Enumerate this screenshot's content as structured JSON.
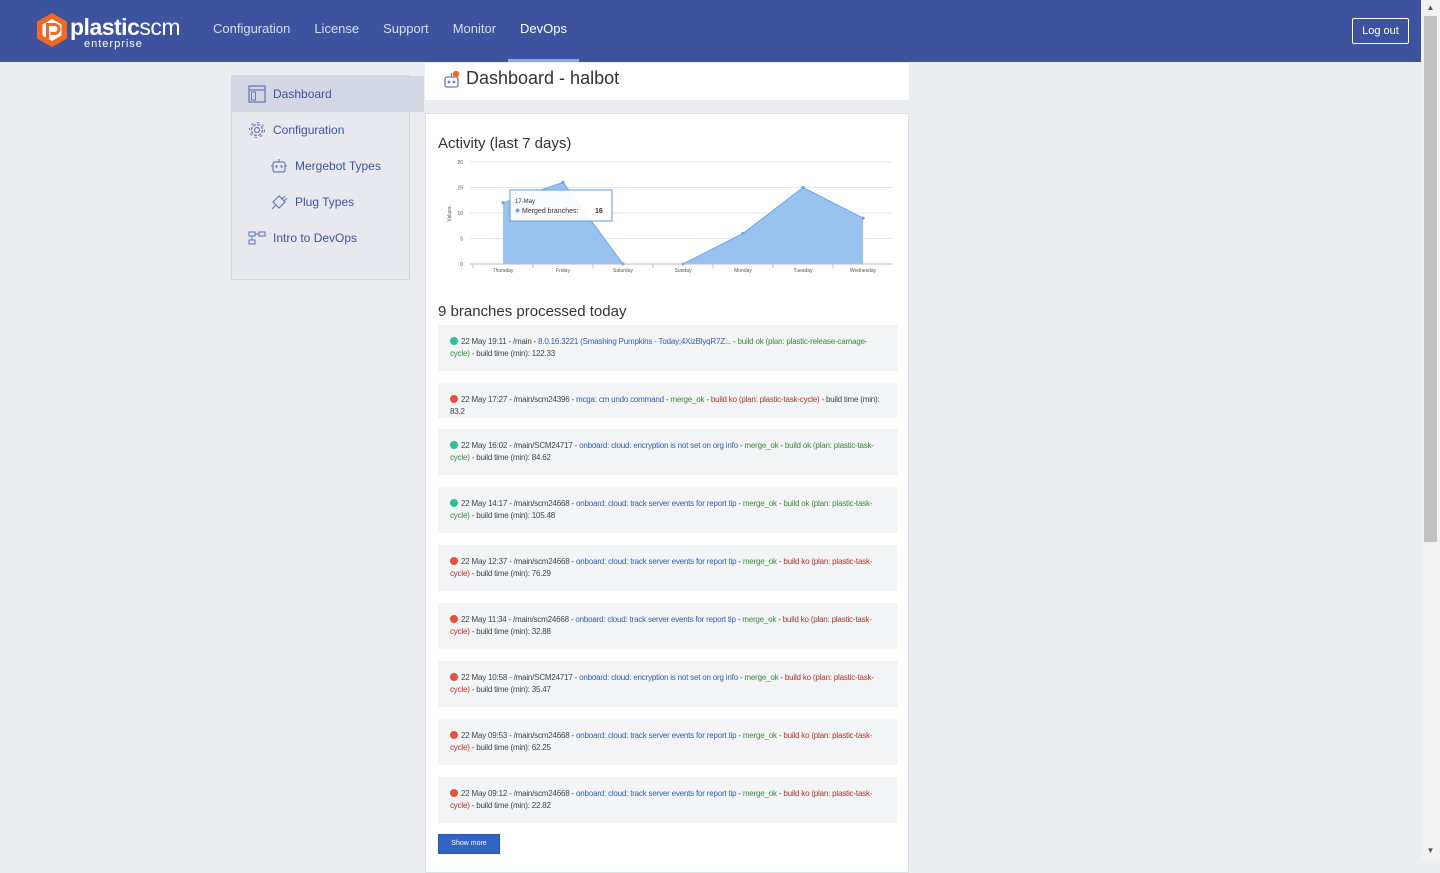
{
  "header": {
    "logo": {
      "brand_bold": "plastic",
      "brand_light": "scm",
      "sub": "enterprise"
    },
    "nav": [
      {
        "label": "Configuration",
        "active": false
      },
      {
        "label": "License",
        "active": false
      },
      {
        "label": "Support",
        "active": false
      },
      {
        "label": "Monitor",
        "active": false
      },
      {
        "label": "DevOps",
        "active": true
      }
    ],
    "logout_label": "Log out"
  },
  "sidebar": {
    "items": [
      {
        "label": "Dashboard",
        "icon": "dashboard-icon",
        "active": true,
        "indent": false
      },
      {
        "label": "Configuration",
        "icon": "gear-icon",
        "active": false,
        "indent": false
      },
      {
        "label": "Mergebot Types",
        "icon": "robot-icon",
        "active": false,
        "indent": true
      },
      {
        "label": "Plug Types",
        "icon": "plug-icon",
        "active": false,
        "indent": true
      },
      {
        "label": "Intro to DevOps",
        "icon": "devops-intro-icon",
        "active": false,
        "indent": false
      }
    ]
  },
  "page": {
    "title": "Dashboard - halbot",
    "title_icon": "mergebot-icon"
  },
  "activity": {
    "title": "Activity (last 7 days)",
    "tooltip": {
      "date": "17-May",
      "series": "Merged branches:",
      "value": "16"
    }
  },
  "chart_data": {
    "type": "area",
    "categories": [
      "Thursday",
      "Friday",
      "Saturday",
      "Sunday",
      "Monday",
      "Tuesday",
      "Wednesday"
    ],
    "series": [
      {
        "name": "Merged branches",
        "values": [
          12,
          16,
          0,
          0,
          6,
          15,
          9
        ]
      }
    ],
    "ylabel": "Values",
    "ylim": [
      0,
      20
    ],
    "yticks": [
      0,
      5,
      10,
      15,
      20
    ],
    "color": "#8ebbf0",
    "line_color": "#6fa6e8",
    "grid": true
  },
  "branches": {
    "title": "9 branches processed today",
    "entries": [
      {
        "status": "ok",
        "time": "22 May 19:11",
        "branch": "/main",
        "desc": "8.0.16.3221 (Smashing Pumpkins - Today;4XizBlyqR7Z...",
        "merge": "",
        "build": "build ok (plan: plastic-release-carnage-cycle)",
        "build_time": "build time (min): 122.33"
      },
      {
        "status": "ko",
        "time": "22 May 17:27",
        "branch": "/main/scm24396",
        "desc": "mcga: cm undo command",
        "merge": "merge_ok",
        "build": "build ko (plan: plastic-task-cycle)",
        "build_time": "build time (min): 83.2"
      },
      {
        "status": "ok",
        "time": "22 May 16:02",
        "branch": "/main/SCM24717",
        "desc": "onboard: cloud: encryption is not set on org info",
        "merge": "merge_ok",
        "build": "build ok (plan: plastic-task-cycle)",
        "build_time": "build time (min): 84.62"
      },
      {
        "status": "ok",
        "time": "22 May 14:17",
        "branch": "/main/scm24668",
        "desc": "onboard: cloud: track server events for report tip",
        "merge": "merge_ok",
        "build": "build ok (plan: plastic-task-cycle)",
        "build_time": "build time (min): 105.48"
      },
      {
        "status": "ko",
        "time": "22 May 12:37",
        "branch": "/main/scm24668",
        "desc": "onboard: cloud: track server events for report tip",
        "merge": "merge_ok",
        "build": "build ko (plan: plastic-task-cycle)",
        "build_time": "build time (min): 76.29"
      },
      {
        "status": "ko",
        "time": "22 May 11:34",
        "branch": "/main/scm24668",
        "desc": "onboard: cloud: track server events for report tip",
        "merge": "merge_ok",
        "build": "build ko (plan: plastic-task-cycle)",
        "build_time": "build time (min): 32.88"
      },
      {
        "status": "ko",
        "time": "22 May 10:58",
        "branch": "/main/SCM24717",
        "desc": "onboard: cloud: encryption is not set on org info",
        "merge": "merge_ok",
        "build": "build ko (plan: plastic-task-cycle)",
        "build_time": "build time (min): 35.47"
      },
      {
        "status": "ko",
        "time": "22 May 09:53",
        "branch": "/main/scm24668",
        "desc": "onboard: cloud: track server events for report tip",
        "merge": "merge_ok",
        "build": "build ko (plan: plastic-task-cycle)",
        "build_time": "build time (min): 62.25"
      },
      {
        "status": "ko",
        "time": "22 May 09:12",
        "branch": "/main/scm24668",
        "desc": "onboard: cloud: track server events for report tip",
        "merge": "merge_ok",
        "build": "build ko (plan: plastic-task-cycle)",
        "build_time": "build time (min): 22.82"
      }
    ],
    "show_more_label": "Show more"
  }
}
